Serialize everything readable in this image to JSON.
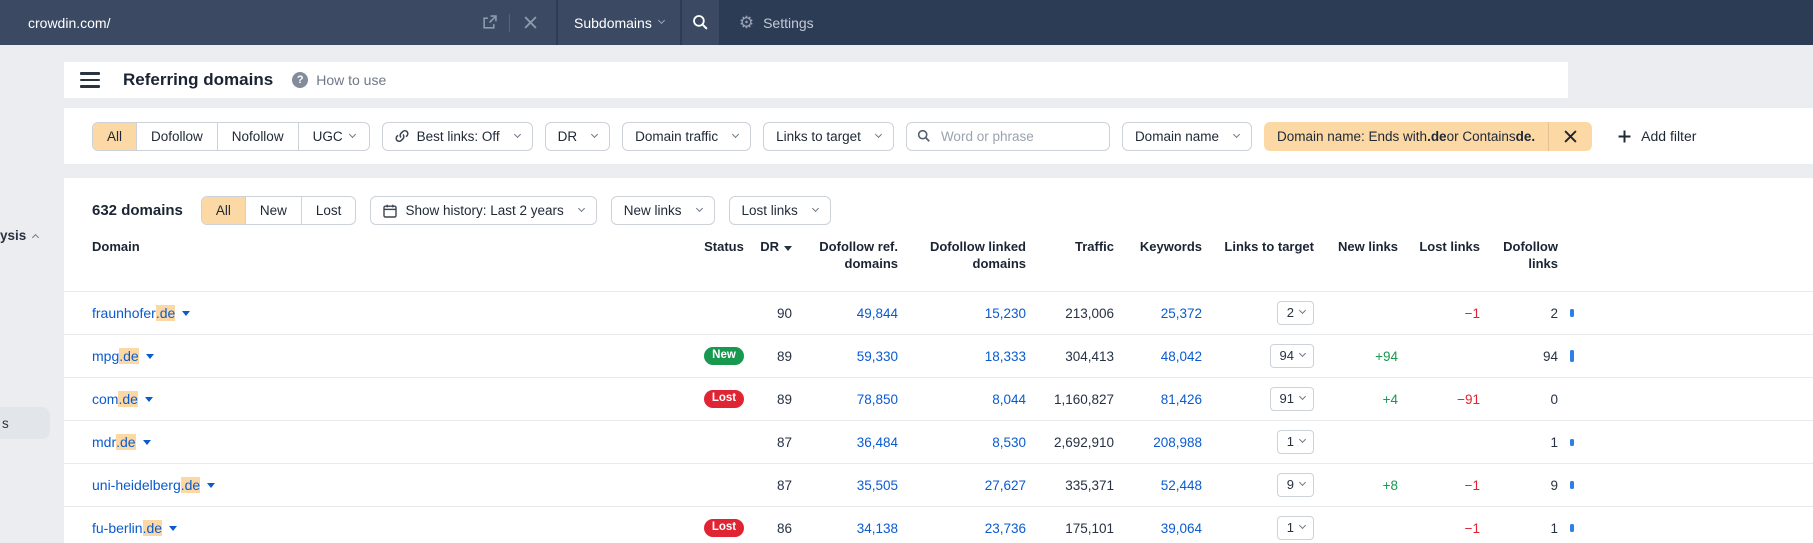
{
  "topbar": {
    "url": "crowdin.com/",
    "mode_button": "Subdomains",
    "settings_label": "Settings"
  },
  "sidebar": {
    "collapsed_section_fragment": "ysis",
    "active_item_fragment": "s"
  },
  "header": {
    "title": "Referring domains",
    "help_label": "How to use",
    "help_glyph": "?"
  },
  "filters": {
    "segmented": {
      "all": "All",
      "dofollow": "Dofollow",
      "nofollow": "Nofollow",
      "ugc": "UGC"
    },
    "best_links": "Best links: Off",
    "dr": "DR",
    "domain_traffic": "Domain traffic",
    "links_to_target": "Links to target",
    "search_placeholder": "Word or phrase",
    "domain_name": "Domain name",
    "chip": {
      "prefix": "Domain name: Ends with ",
      "bold1": ".de",
      "middle": " or Contains ",
      "bold2": "de."
    },
    "add_filter": "Add filter"
  },
  "toolbar": {
    "count": "632 domains",
    "segmented": {
      "all": "All",
      "new": "New",
      "lost": "Lost"
    },
    "show_history": "Show history: Last 2 years",
    "new_links": "New links",
    "lost_links": "Lost links"
  },
  "table": {
    "columns": [
      "Domain",
      "Status",
      "DR",
      "Dofollow ref. domains",
      "Dofollow linked domains",
      "Traffic",
      "Keywords",
      "Links to target",
      "New links",
      "Lost links",
      "Dofollow links"
    ],
    "rows": [
      {
        "domain_pre": "fraunhofer",
        "domain_highlight": ".de",
        "status": null,
        "dr": "90",
        "dofollow_ref": "49,844",
        "dofollow_linked": "15,230",
        "traffic": "213,006",
        "keywords": "25,372",
        "links_to_target": "2",
        "new_links": "",
        "lost_links": "−1",
        "dofollow_links": "2",
        "spark": 8
      },
      {
        "domain_pre": "mpg",
        "domain_highlight": ".de",
        "status": {
          "label": "New",
          "color": "green"
        },
        "dr": "89",
        "dofollow_ref": "59,330",
        "dofollow_linked": "18,333",
        "traffic": "304,413",
        "keywords": "48,042",
        "links_to_target": "94",
        "new_links": "+94",
        "lost_links": "",
        "dofollow_links": "94",
        "spark": 12
      },
      {
        "domain_pre": "com",
        "domain_highlight": ".de",
        "status": {
          "label": "Lost",
          "color": "red"
        },
        "dr": "89",
        "dofollow_ref": "78,850",
        "dofollow_linked": "8,044",
        "traffic": "1,160,827",
        "keywords": "81,426",
        "links_to_target": "91",
        "new_links": "+4",
        "lost_links": "−91",
        "dofollow_links": "0",
        "spark": 0
      },
      {
        "domain_pre": "mdr",
        "domain_highlight": ".de",
        "status": null,
        "dr": "87",
        "dofollow_ref": "36,484",
        "dofollow_linked": "8,530",
        "traffic": "2,692,910",
        "keywords": "208,988",
        "links_to_target": "1",
        "new_links": "",
        "lost_links": "",
        "dofollow_links": "1",
        "spark": 7
      },
      {
        "domain_pre": "uni-heidelberg",
        "domain_highlight": ".de",
        "status": null,
        "dr": "87",
        "dofollow_ref": "35,505",
        "dofollow_linked": "27,627",
        "traffic": "335,371",
        "keywords": "52,448",
        "links_to_target": "9",
        "new_links": "+8",
        "lost_links": "−1",
        "dofollow_links": "9",
        "spark": 8
      },
      {
        "domain_pre": "fu-berlin",
        "domain_highlight": ".de",
        "status": {
          "label": "Lost",
          "color": "red"
        },
        "dr": "86",
        "dofollow_ref": "34,138",
        "dofollow_linked": "23,736",
        "traffic": "175,101",
        "keywords": "39,064",
        "links_to_target": "1",
        "new_links": "",
        "lost_links": "−1",
        "dofollow_links": "1",
        "spark": 8
      }
    ]
  },
  "colors": {
    "topbar": "#2d3c55",
    "accent": "#fcd9a4",
    "link_blue": "#0a5bd0",
    "green": "#17994f",
    "red": "#e02434",
    "spark_blue": "#2e7fe8",
    "page_bg": "#ecedf0"
  }
}
